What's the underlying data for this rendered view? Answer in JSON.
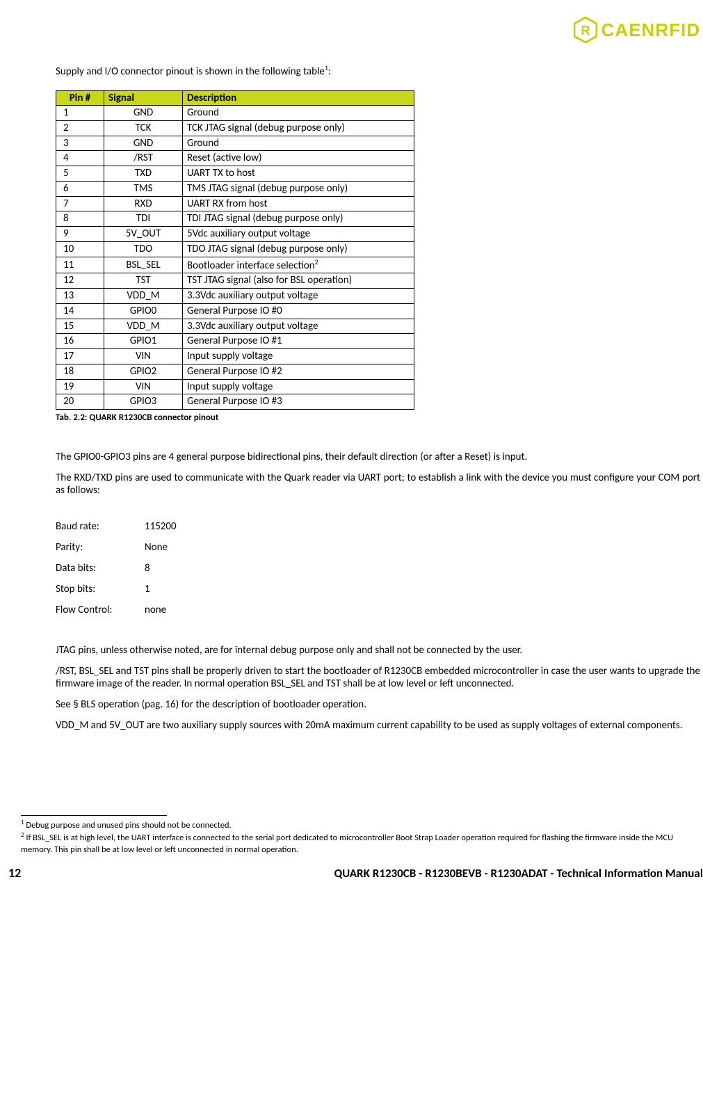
{
  "brand": "CAENRFID",
  "intro_pre": "Supply and I/O connector pinout is shown in the following table",
  "intro_sup": "1",
  "intro_post": ":",
  "table_headers": {
    "pin": "Pin #",
    "signal": "Signal",
    "desc": "Description"
  },
  "pinout": [
    {
      "pin": "1",
      "signal": "GND",
      "desc": "Ground"
    },
    {
      "pin": "2",
      "signal": "TCK",
      "desc": "TCK JTAG signal (debug purpose only)"
    },
    {
      "pin": "3",
      "signal": "GND",
      "desc": "Ground"
    },
    {
      "pin": "4",
      "signal": "/RST",
      "desc": "Reset (active low)"
    },
    {
      "pin": "5",
      "signal": "TXD",
      "desc": "UART TX to host"
    },
    {
      "pin": "6",
      "signal": "TMS",
      "desc": "TMS JTAG signal (debug purpose only)"
    },
    {
      "pin": "7",
      "signal": "RXD",
      "desc": "UART RX from host"
    },
    {
      "pin": "8",
      "signal": "TDI",
      "desc": "TDI JTAG signal (debug purpose only)"
    },
    {
      "pin": "9",
      "signal": "5V_OUT",
      "desc": "5Vdc auxiliary output voltage"
    },
    {
      "pin": "10",
      "signal": "TDO",
      "desc": "TDO JTAG signal (debug purpose only)"
    },
    {
      "pin": "11",
      "signal": "BSL_SEL",
      "desc": "Bootloader interface selection",
      "sup": "2"
    },
    {
      "pin": "12",
      "signal": "TST",
      "desc": "TST JTAG signal (also for BSL operation)"
    },
    {
      "pin": "13",
      "signal": "VDD_M",
      "desc": "3.3Vdc auxiliary output voltage"
    },
    {
      "pin": "14",
      "signal": "GPIO0",
      "desc": "General Purpose IO #0"
    },
    {
      "pin": "15",
      "signal": "VDD_M",
      "desc": "3.3Vdc auxiliary output voltage"
    },
    {
      "pin": "16",
      "signal": "GPIO1",
      "desc": "General Purpose IO #1"
    },
    {
      "pin": "17",
      "signal": "VIN",
      "desc": "Input supply voltage"
    },
    {
      "pin": "18",
      "signal": "GPIO2",
      "desc": "General Purpose IO #2"
    },
    {
      "pin": "19",
      "signal": "VIN",
      "desc": "Input supply voltage"
    },
    {
      "pin": "20",
      "signal": "GPIO3",
      "desc": "General Purpose IO #3"
    }
  ],
  "caption": "Tab. 2.2: QUARK R1230CB connector pinout",
  "para1": "The GPIO0-GPIO3 pins are 4 general purpose bidirectional pins, their default direction (or after a Reset) is input.",
  "para2": "The RXD/TXD pins are used to communicate with the Quark reader via UART port; to establish a link with the device you must configure your COM port as follows:",
  "com": [
    {
      "label": "Baud rate:",
      "value": "115200"
    },
    {
      "label": "Parity:",
      "value": "None"
    },
    {
      "label": "Data bits:",
      "value": "8"
    },
    {
      "label": "Stop bits:",
      "value": " 1"
    },
    {
      "label": "Flow Control:",
      "value": "none"
    }
  ],
  "para3": "JTAG pins, unless otherwise noted, are for internal debug purpose only and shall not be connected by the user.",
  "para4": "/RST, BSL_SEL and TST pins shall be properly driven to start the bootloader of R1230CB embedded microcontroller in case the user wants to upgrade the firmware image of the reader. In normal operation BSL_SEL and TST shall be at low level or left unconnected.",
  "para5": "See § BLS operation (pag. 16) for the description of bootloader operation.",
  "para6": "VDD_M and 5V_OUT are two auxiliary supply sources with 20mA maximum current capability to be used as supply voltages of external components.",
  "footnote1_sup": "1",
  "footnote1": " Debug purpose and unused pins should not be connected.",
  "footnote2_sup": "2",
  "footnote2": " If BSL_SEL is at high level, the UART interface is connected to the serial port dedicated to microcontroller Boot Strap Loader operation required for flashing the firmware inside the MCU memory. This pin shall be at low level or left unconnected in normal operation.",
  "page_number": "12",
  "footer_title": "QUARK R1230CB - R1230BEVB - R1230ADAT - Technical Information Manual"
}
